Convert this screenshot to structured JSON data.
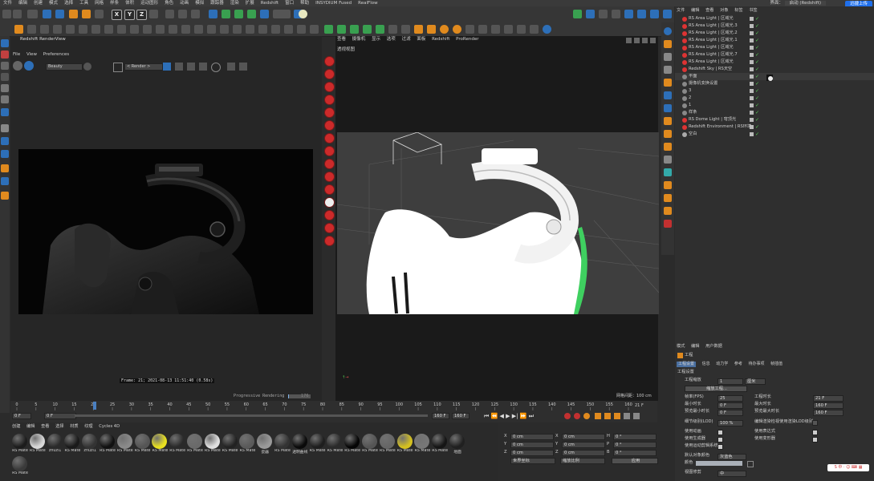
{
  "menubar": {
    "items": [
      "文件",
      "编辑",
      "创建",
      "模式",
      "选择",
      "工具",
      "网格",
      "样条",
      "体积",
      "运动图形",
      "角色",
      "动画",
      "模拟",
      "跟踪器",
      "渲染",
      "扩展",
      "Redshift",
      "窗口",
      "帮助",
      "INSYDIUM Fused",
      "RealFlow"
    ],
    "layout_label": "界面：",
    "layout_value": "启动 (Redshift)",
    "upload_button": "迅捷上传"
  },
  "render_view": {
    "title": "Redshift RenderView",
    "menu": [
      "File",
      "View",
      "Preferences"
    ],
    "aov": "Beauty",
    "render_dropdown": "< Render >",
    "status": "Frame: 21;  2021-08-13  11:51:40  (0.58s)",
    "progress_label": "Progressive Rendering",
    "progress_value": "176",
    "progress_fraction": 0.03
  },
  "viewport": {
    "menu": [
      "查看",
      "摄像机",
      "显示",
      "选项",
      "过滤",
      "面板",
      "Redshift",
      "ProRender"
    ],
    "label": "透视视图",
    "grid_info": "网格间距：100 cm"
  },
  "timeline": {
    "ticks": [
      "0",
      "5",
      "10",
      "15",
      "20",
      "25",
      "30",
      "35",
      "40",
      "45",
      "50",
      "55",
      "60",
      "65",
      "70",
      "75",
      "80",
      "85",
      "90",
      "95",
      "100",
      "105",
      "110",
      "115",
      "120",
      "125",
      "130",
      "135",
      "140",
      "145",
      "150",
      "155",
      "160"
    ],
    "current": "21",
    "current_right": "21 F",
    "start": "0 F",
    "start2": "0 F",
    "end": "160 F",
    "end2": "160 F"
  },
  "materials": {
    "menu": [
      "创建",
      "编辑",
      "查看",
      "选择",
      "材质",
      "纹理",
      "Cycles 4D"
    ],
    "items": [
      {
        "label": "RS Mate",
        "color": "#1c1c1c"
      },
      {
        "label": "RS Mate",
        "color": "#d8d8d8"
      },
      {
        "label": "zhuzi1",
        "color": "#2a2a2a"
      },
      {
        "label": "RS Mate",
        "color": "#1a1a1a"
      },
      {
        "label": "zhuzi1",
        "color": "#333333"
      },
      {
        "label": "RS Mate",
        "color": "#111111"
      },
      {
        "label": "RS Mate",
        "color": "#8a8a8a"
      },
      {
        "label": "RS Mate",
        "color": "#555555"
      },
      {
        "label": "RS Mate",
        "color": "#e8e020"
      },
      {
        "label": "RS Mate",
        "color": "#2a2a2a"
      },
      {
        "label": "RS Mate",
        "color": "#6a6a6a"
      },
      {
        "label": "RS Mate",
        "color": "#e0e0e0"
      },
      {
        "label": "RS Mate",
        "color": "#222222"
      },
      {
        "label": "RS Mate",
        "color": "#5a5a5a"
      },
      {
        "label": "瓷器",
        "color": "#9a9a9a"
      },
      {
        "label": "RS Mate",
        "color": "#333333"
      },
      {
        "label": "透明曲线",
        "color": "#0a0a0a"
      },
      {
        "label": "RS Mate",
        "color": "#1e1e1e"
      },
      {
        "label": "RS Mate",
        "color": "#2a2a2a"
      },
      {
        "label": "RS Mate",
        "color": "#050505"
      },
      {
        "label": "RS Mate",
        "color": "#555555"
      },
      {
        "label": "RS Mate",
        "color": "#666666"
      },
      {
        "label": "RS Mate",
        "color": "#d4c020"
      },
      {
        "label": "RS Mate",
        "color": "#777777"
      },
      {
        "label": "RS Mate",
        "color": "#151515"
      },
      {
        "label": "地面",
        "color": "#202020"
      },
      {
        "label": "RS Mate",
        "color": "#3a3a3a"
      }
    ]
  },
  "coords": {
    "rows": [
      {
        "a": "X",
        "v1": "0 cm",
        "b": "X",
        "v2": "0 cm",
        "c": "H",
        "v3": "0 °"
      },
      {
        "a": "Y",
        "v1": "0 cm",
        "b": "Y",
        "v2": "0 cm",
        "c": "P",
        "v3": "0 °"
      },
      {
        "a": "Z",
        "v1": "0 cm",
        "b": "Z",
        "v2": "0 cm",
        "c": "B",
        "v3": "0 °"
      }
    ],
    "dropdown1": "世界坐标",
    "dropdown2": "缩放比例",
    "apply": "应用"
  },
  "object_manager": {
    "menu": [
      "文件",
      "编辑",
      "查看",
      "对象",
      "标签",
      "书签"
    ],
    "rows": [
      "RS Area Light | 区域光",
      "RS Area Light | 区域光.3",
      "RS Area Light | 区域光.2",
      "RS Area Light | 区域光.1",
      "RS Area Light | 区域光",
      "RS Area Light | 区域光.7",
      "RS Area Light | 区域光",
      "Redshift Sky | RS天空",
      "平面",
      "摄像机变换设置",
      "3",
      "2",
      "1",
      "样条",
      "RS Dome Light | 穹顶光",
      "Redshift Environment | RS环境",
      "空白"
    ]
  },
  "attributes": {
    "menu": [
      "模式",
      "编辑",
      "用户数据"
    ],
    "title": "工程",
    "tabs": [
      "工程设置",
      "信息",
      "动力学",
      "参考",
      "待办事项",
      "帧插值"
    ],
    "section": "工程设置",
    "scale_label": "工程缩放",
    "scale_value": "1",
    "scale_unit": "厘米",
    "scale_button": "缩放工程...",
    "fps_label": "帧率(FPS)",
    "fps_value": "25",
    "proj_time_label": "工程时长",
    "proj_time_value": "21 F",
    "min_time_label": "最小时长",
    "min_time_value": "0 F",
    "max_time_label": "最大时长",
    "max_time_value": "160 F",
    "prev_min_label": "预览最小时长",
    "prev_min_value": "0 F",
    "prev_max_label": "预览最大时长",
    "prev_max_value": "160 F",
    "lod_label": "细节级别(LOD)",
    "lod_value": "100 %",
    "lod_check": "编辑渲染检视使用渲染LOD级别",
    "anim_label": "使用动画",
    "expr_label": "使用表达式",
    "gen_label": "使用生成器",
    "deform_label": "使用变形器",
    "motion_label": "使用运动剪辑系统",
    "color_label": "默认对象颜色",
    "color_value": "灰蓝色",
    "color2_label": "颜色",
    "clip_label": "视图修剪",
    "clip_value": "中"
  },
  "colors": {
    "accent_blue": "#2d6fb8",
    "red_icon": "#cc2a2a",
    "green_check": "#55cc55"
  }
}
